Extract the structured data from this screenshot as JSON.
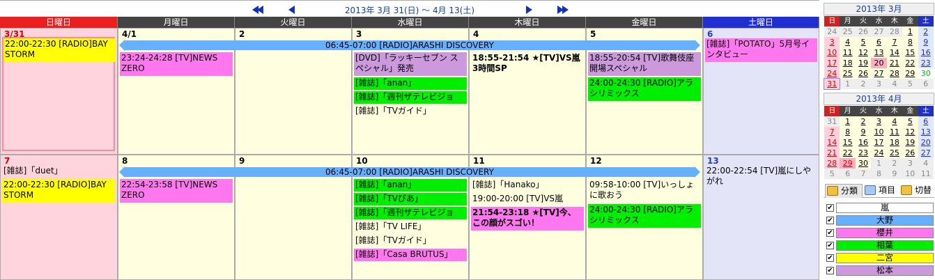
{
  "nav": {
    "range": "2013年 3月 31(日) ～ 4月 13(土)"
  },
  "weekdays": [
    "日曜日",
    "月曜日",
    "火曜日",
    "水曜日",
    "木曜日",
    "金曜日",
    "土曜日"
  ],
  "week1": {
    "days": [
      "3/31",
      "4/1",
      "2",
      "3",
      "4",
      "5",
      "6"
    ],
    "banner": "06:45-07:00 [RADIO]ARASHI DISCOVERY",
    "sun_ev1": "22:00-22:30 [RADIO]BAY STORM",
    "mon_ev1": "23:24-24:28 [TV]NEWS ZERO",
    "wed_ev1": "[DVD]「ラッキーセブン スペシャル」発売",
    "wed_ev2": "[雑誌]「anan」",
    "wed_ev3": "[雑誌]「週刊ザテレビジョン」",
    "wed_ev4": "[雑誌]「TVガイド」",
    "thu_ev1": "18:55-21:54 ★[TV]VS嵐3時間SP",
    "fri_ev1": "18:55-20:54 [TV]歌舞伎座開場スペシャル",
    "fri_ev2": "24:00-24:30 [RADIO]アラシリミックス",
    "sat_ev1": "[雑誌]「POTATO」5月号インタビュー"
  },
  "week2": {
    "days": [
      "7",
      "8",
      "9",
      "10",
      "11",
      "12",
      "13"
    ],
    "banner": "06:45-07:00 [RADIO]ARASHI DISCOVERY",
    "sun_ev1": "[雑誌]「duet」",
    "sun_ev2": "22:00-22:30 [RADIO]BAY STORM",
    "mon_ev1": "22:54-23:58 [TV]NEWS ZERO",
    "wed_ev1": "[雑誌]「anan」",
    "wed_ev2": "[雑誌]「TVぴあ」",
    "wed_ev3": "[雑誌]「週刊ザテレビジョン」",
    "wed_ev4": "[雑誌]「TV LIFE」",
    "wed_ev5": "[雑誌]「TVガイド」",
    "wed_ev6": "[雑誌]「Casa BRUTUS」",
    "thu_ev1": "[雑誌]「Hanako」",
    "thu_ev2": "19:00-20:00 [TV]VS嵐",
    "thu_ev3": "21:54-23:18 ★[TV]今、この顔がスゴい！",
    "fri_ev1": "09:58-10:00 [TV]いっしょに歌おう",
    "fri_ev2": "24:00-24:30 [RADIO]アラシリミックス",
    "sat_ev1": "22:00-22:54 [TV]嵐にしやがれ"
  },
  "mini_march": {
    "title": "2013年 3月",
    "head": [
      "日",
      "月",
      "火",
      "水",
      "木",
      "金",
      "土"
    ],
    "rows": [
      [
        "24",
        "25",
        "26",
        "27",
        "28",
        "1",
        "2"
      ],
      [
        "3",
        "4",
        "5",
        "6",
        "7",
        "8",
        "9"
      ],
      [
        "10",
        "11",
        "12",
        "13",
        "14",
        "15",
        "16"
      ],
      [
        "17",
        "18",
        "19",
        "20",
        "21",
        "22",
        "23"
      ],
      [
        "24",
        "25",
        "26",
        "27",
        "28",
        "29",
        "30"
      ],
      [
        "31",
        "1",
        "2",
        "3",
        "4",
        "5",
        "6"
      ]
    ]
  },
  "mini_april": {
    "title": "2013年 4月",
    "head": [
      "日",
      "月",
      "火",
      "水",
      "木",
      "金",
      "土"
    ],
    "rows": [
      [
        "31",
        "1",
        "2",
        "3",
        "4",
        "5",
        "6"
      ],
      [
        "7",
        "8",
        "9",
        "10",
        "11",
        "12",
        "13"
      ],
      [
        "14",
        "15",
        "16",
        "17",
        "18",
        "19",
        "20"
      ],
      [
        "21",
        "22",
        "23",
        "24",
        "25",
        "26",
        "27"
      ],
      [
        "28",
        "29",
        "30",
        "1",
        "2",
        "3",
        "4"
      ],
      [
        "5",
        "6",
        "7",
        "8",
        "9",
        "10",
        "11"
      ]
    ]
  },
  "tabs": {
    "category": "分類",
    "item": "項目",
    "switch": "切替"
  },
  "filters": [
    {
      "label": "嵐",
      "color": "#ffffff"
    },
    {
      "label": "大野",
      "color": "#66b0ff"
    },
    {
      "label": "櫻井",
      "color": "#ff77ee"
    },
    {
      "label": "相葉",
      "color": "#00ee00"
    },
    {
      "label": "二宮",
      "color": "#ffff00"
    },
    {
      "label": "松本",
      "color": "#cc99dd"
    }
  ],
  "check": "✔"
}
